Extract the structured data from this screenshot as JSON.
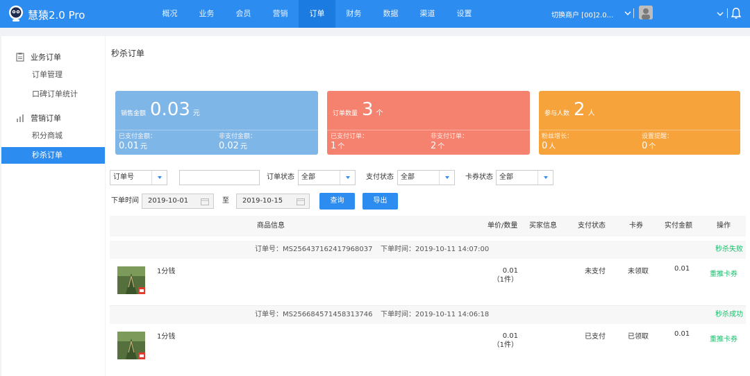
{
  "app": {
    "brand": "慧猿2.0 Pro",
    "nav": [
      "概况",
      "业务",
      "会员",
      "营销",
      "订单",
      "财务",
      "数据",
      "渠道",
      "设置"
    ],
    "active_nav": "订单",
    "merchant_text": "切换商户  [00]2.0...",
    "icons": [
      "robot-logo-icon",
      "chevron-down-icon",
      "bell-icon"
    ]
  },
  "sidebar": {
    "groups": [
      {
        "title": "业务订单",
        "icon": "clipboard-icon",
        "items": [
          "订单管理",
          "口碑订单统计"
        ]
      },
      {
        "title": "营销订单",
        "icon": "bar-chart-icon",
        "items": [
          "积分商城",
          "秒杀订单"
        ]
      }
    ],
    "active_item": "秒杀订单"
  },
  "page": {
    "title": "秒杀订单"
  },
  "stats": [
    {
      "label": "销售金额",
      "value": "0.03",
      "unit": "元",
      "color": "#7fb6e8",
      "sub": [
        {
          "label": "已支付金额：",
          "value": "0.01",
          "unit": "元"
        },
        {
          "label": "非支付金额：",
          "value": "0.02",
          "unit": "元"
        }
      ]
    },
    {
      "label": "订单数量",
      "value": "3",
      "unit": "个",
      "color": "#f5826e",
      "sub": [
        {
          "label": "已支付订单：",
          "value": "1",
          "unit": "个"
        },
        {
          "label": "非支付订单：",
          "value": "2",
          "unit": "个"
        }
      ]
    },
    {
      "label": "参与人数",
      "value": "2",
      "unit": "人",
      "color": "#f7a33c",
      "sub": [
        {
          "label": "粉丝增长：",
          "value": "0",
          "unit": "人"
        },
        {
          "label": "设置提醒：",
          "value": "0",
          "unit": "个"
        }
      ]
    }
  ],
  "filters": {
    "search_field": "订单号",
    "search_value": "",
    "order_status_label": "订单状态",
    "order_status": "全部",
    "pay_status_label": "支付状态",
    "pay_status": "全部",
    "coupon_status_label": "卡券状态",
    "coupon_status": "全部",
    "time_label": "下单时间",
    "date_from": "2019-10-01",
    "date_sep": "至",
    "date_to": "2019-10-15",
    "query_button": "查询",
    "export_button": "导出"
  },
  "table": {
    "columns": [
      "商品信息",
      "单价/数量",
      "买家信息",
      "支付状态",
      "卡券",
      "实付金额",
      "操作"
    ],
    "orders": [
      {
        "order_no": "订单号：MS256437162417968037",
        "order_time": "下单时间：2019-10-11 14:07:00",
        "result": "秒杀失败",
        "product": "1分钱",
        "unit_price": "0.01",
        "qty": "（1件）",
        "buyer": "",
        "pay_status": "未支付",
        "coupon": "未领取",
        "paid": "0.01",
        "action": "重推卡券"
      },
      {
        "order_no": "订单号：MS256684571458313746",
        "order_time": "下单时间：2019-10-11 14:06:18",
        "result": "秒杀成功",
        "product": "1分钱",
        "unit_price": "0.01",
        "qty": "（1件）",
        "buyer": "",
        "pay_status": "已支付",
        "coupon": "已领取",
        "paid": "0.01",
        "action": "重推卡券"
      }
    ]
  }
}
